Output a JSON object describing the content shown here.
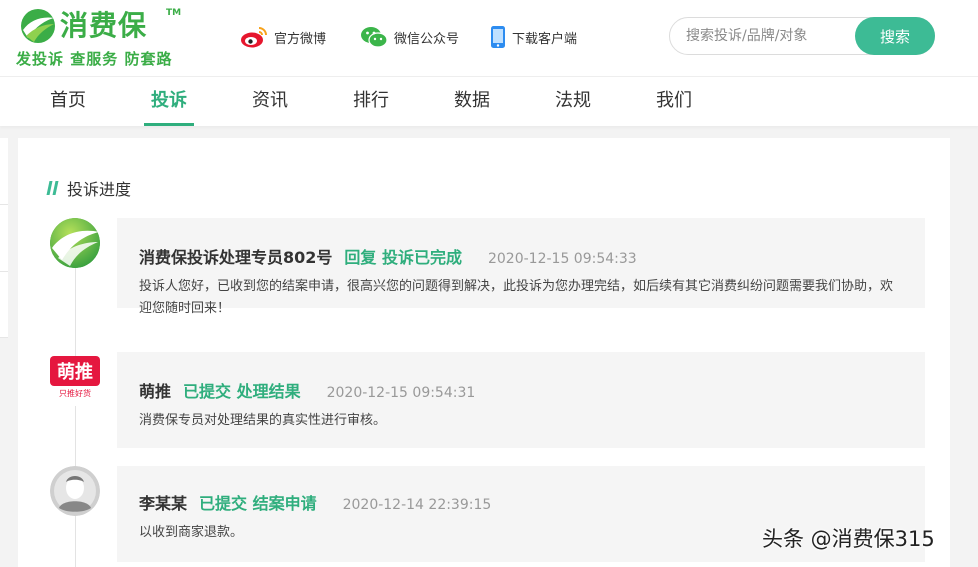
{
  "header": {
    "logo_name": "消费保",
    "logo_tm": "TM",
    "logo_slogan": "发投诉 查服务 防套路",
    "links": [
      {
        "label": "官方微博",
        "icon": "weibo-icon"
      },
      {
        "label": "微信公众号",
        "icon": "wechat-icon"
      },
      {
        "label": "下载客户端",
        "icon": "mobile-phone-icon"
      }
    ],
    "search": {
      "placeholder": "搜索投诉/品牌/对象",
      "value": "",
      "button_label": "搜索"
    }
  },
  "nav": {
    "items": [
      "首页",
      "投诉",
      "资讯",
      "排行",
      "数据",
      "法规",
      "我们"
    ],
    "active_index": 1
  },
  "progress": {
    "title": "投诉进度",
    "entries": [
      {
        "author": "消费保投诉处理专员802号",
        "action": "回复 投诉已完成",
        "time": "2020-12-15 09:54:33",
        "text": "投诉人您好，已收到您的结案申请，很高兴您的问题得到解决，此投诉为您办理完结，如后续有其它消费纠纷问题需要我们协助，欢迎您随时回来！"
      },
      {
        "author": "萌推",
        "action": "已提交 处理结果",
        "time": "2020-12-15 09:54:31",
        "text": "消费保专员对处理结果的真实性进行审核。",
        "avatar_logo_text": "萌推",
        "avatar_logo_sub": "只推好货"
      },
      {
        "author": "李某某",
        "action": "已提交 结案申请",
        "time": "2020-12-14 22:39:15",
        "text": "以收到商家退款。"
      }
    ]
  },
  "watermark": "头条 @消费保315",
  "colors": {
    "brand": "#3bad47",
    "accent": "#2fae7d",
    "button": "#3dbb95",
    "weibo_red": "#e6162d",
    "wechat_green": "#3bb54a",
    "phone_blue": "#2d8cf0",
    "mengtui_red": "#e5173f"
  }
}
